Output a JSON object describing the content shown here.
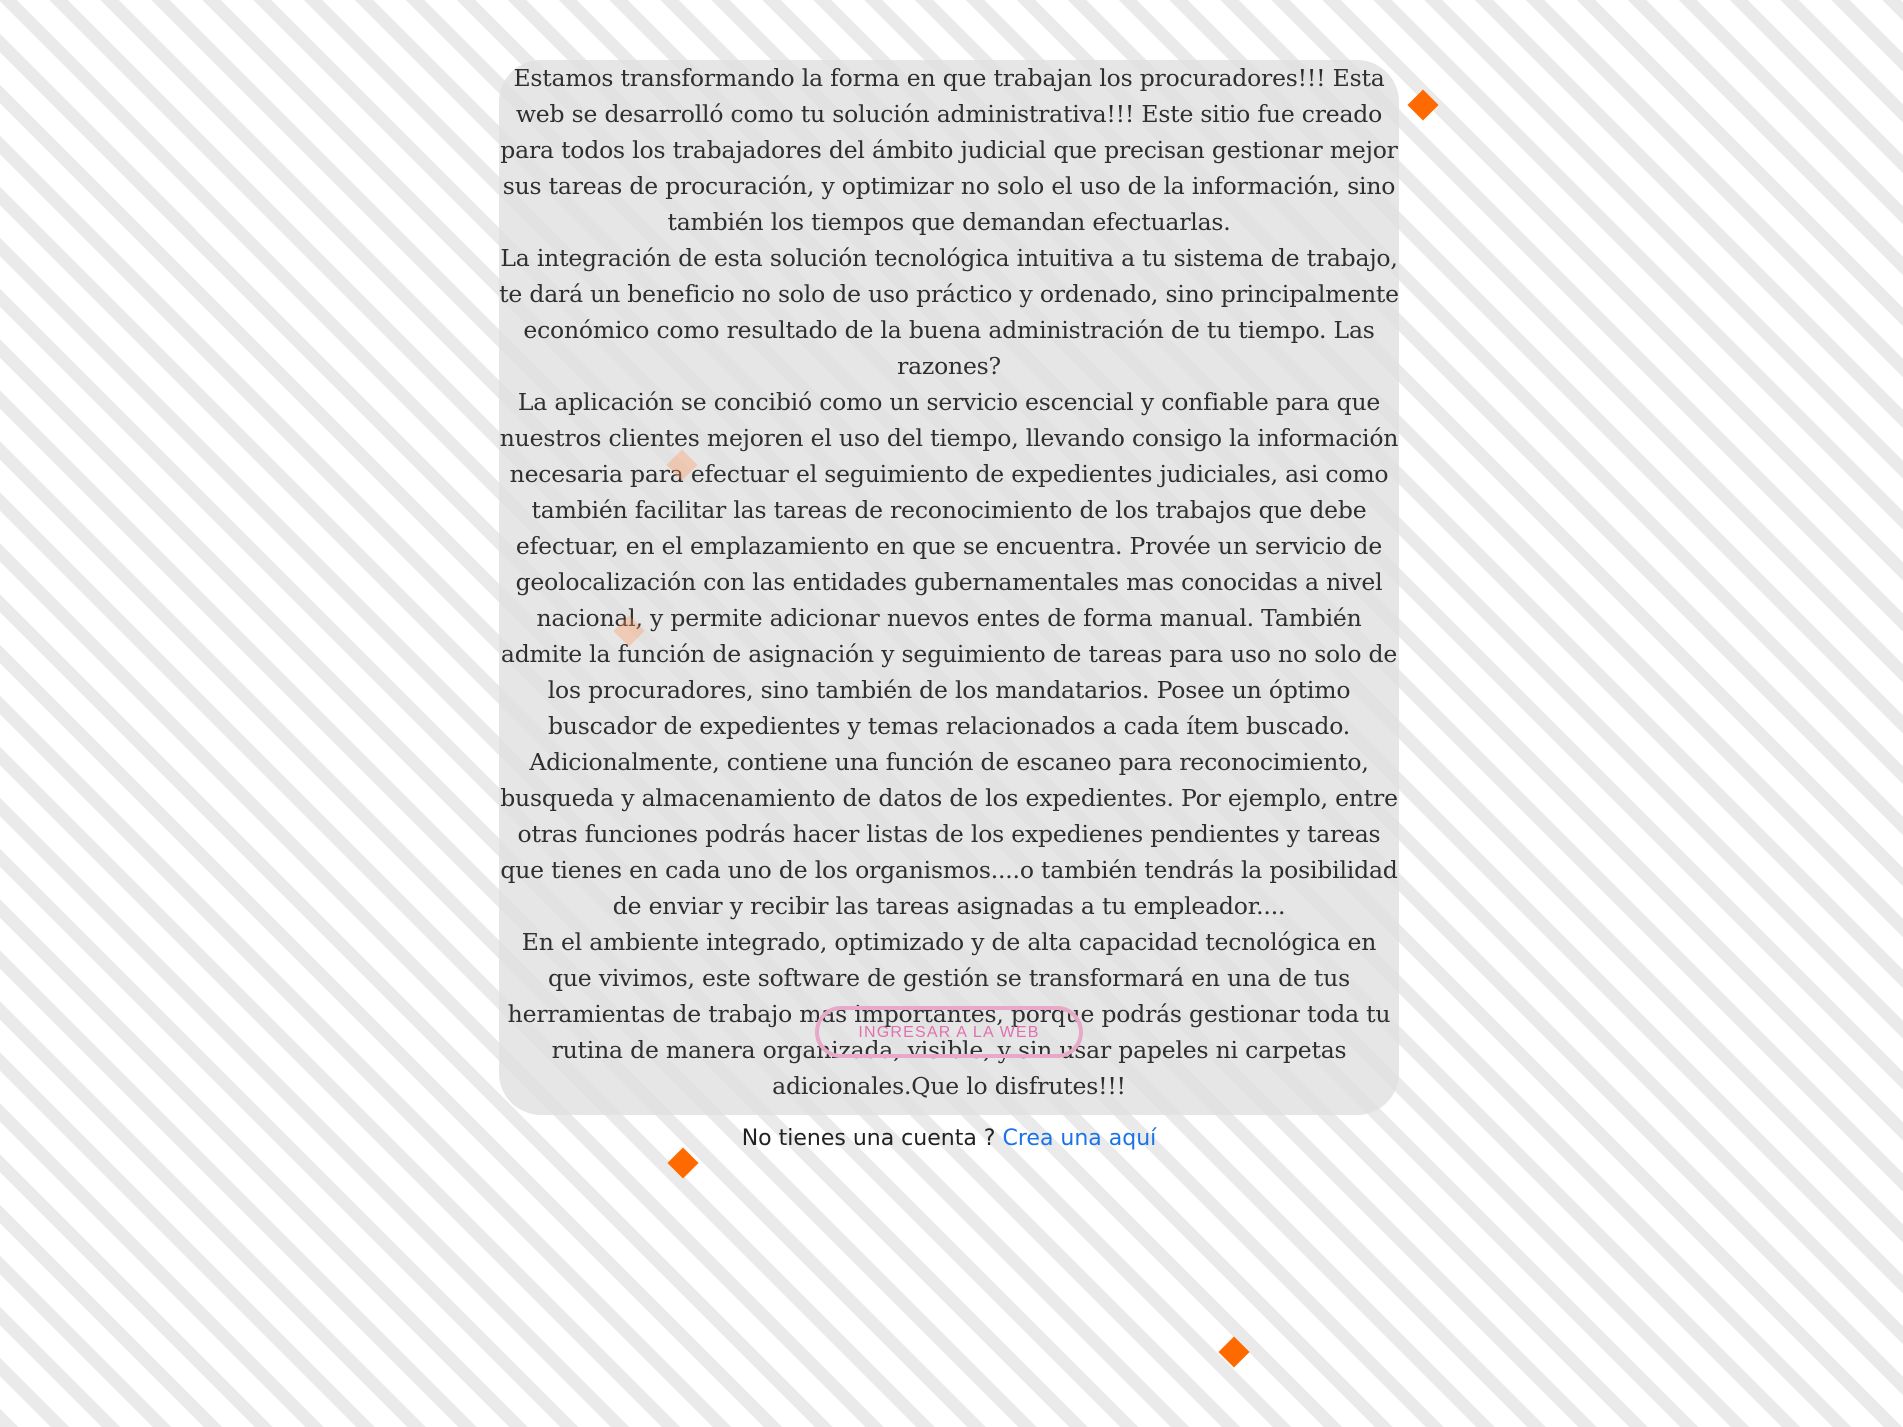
{
  "intro": {
    "paragraphs": [
      "Estamos transformando la forma en que trabajan los procuradores!!! Esta web se desarrolló como tu solución administrativa!!! Este sitio fue creado para todos los trabajadores del ámbito judicial que precisan gestionar mejor sus tareas de procuración, y optimizar no solo el uso de la información, sino también los tiempos que demandan efectuarlas.",
      "La integración de esta solución tecnológica intuitiva a tu sistema de trabajo, te dará un beneficio no solo de uso práctico y ordenado, sino principalmente económico como resultado de la buena administración de tu tiempo. Las razones?",
      "La aplicación se concibió como un servicio escencial y confiable para que nuestros clientes mejoren el uso del tiempo, llevando consigo la información necesaria para efectuar el seguimiento de expedientes judiciales, asi como también facilitar las tareas de reconocimiento de los trabajos que debe efectuar, en el emplazamiento en que se encuentra. Provée un servicio de geolocalización con las entidades gubernamentales mas conocidas a nivel nacional, y permite adicionar nuevos entes de forma manual. También admite la función de asignación y seguimiento de tareas para uso no solo de los procuradores, sino también de los mandatarios. Posee un óptimo buscador de expedientes y temas relacionados a cada ítem buscado. Adicionalmente, contiene una función de escaneo para reconocimiento, busqueda y almacenamiento de datos de los expedientes. Por ejemplo, entre otras funciones podrás hacer listas de los expedienes pendientes y tareas que tienes en cada uno de los organismos....o también tendrás la posibilidad de enviar y recibir las tareas asignadas a tu empleador....",
      "En el ambiente integrado, optimizado y de alta capacidad tecnológica en que vivimos, este software de gestión se transformará en una de tus herramientas de trabajo mas importantes, porque podrás gestionar toda tu rutina de manera organizada, visible, y sin usar papeles ni carpetas adicionales.Que lo disfrutes!!!"
    ]
  },
  "cta": {
    "login_label": "INGRESAR A LA WEB"
  },
  "signup": {
    "prompt": "No tienes una cuenta ? ",
    "link_label": "Crea una aquí"
  },
  "colors": {
    "accent_orange": "#ff6a00",
    "button_border": "#e6a9c7",
    "button_text": "#e070b0",
    "link": "#1a73e8"
  }
}
